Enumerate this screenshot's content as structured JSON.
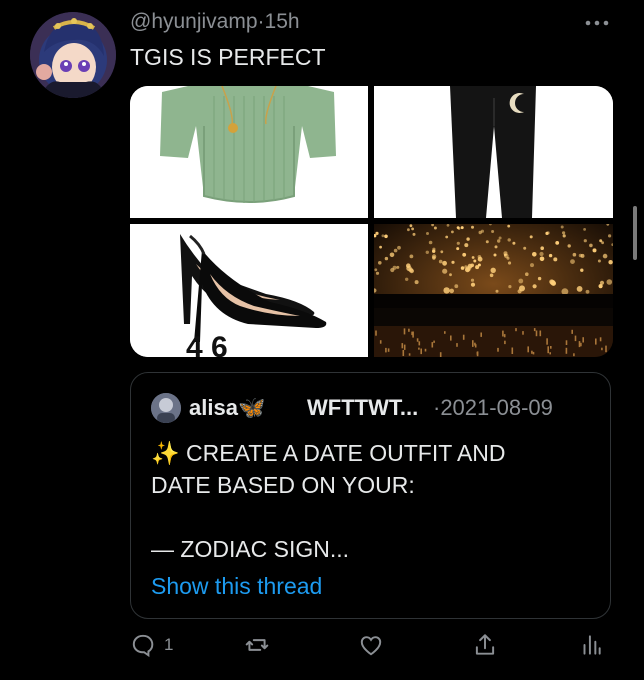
{
  "tweet": {
    "handle": "@hyunjivamp",
    "separator": "·",
    "time": "15h",
    "text": "TGIS IS PERFECT",
    "more_icon": "more-horizontal-icon"
  },
  "media": {
    "images": [
      {
        "name": "green-knit-top-image"
      },
      {
        "name": "black-moon-pants-image"
      },
      {
        "name": "black-slingback-heels-image"
      },
      {
        "name": "sky-lanterns-image"
      }
    ],
    "cutoff_text": "4 6"
  },
  "quote": {
    "name": "alisa",
    "name_emoji": "🦋",
    "handle": "WFTTWT...",
    "date": "·2021-08-09",
    "body_line1": "✨ CREATE A DATE OUTFIT AND",
    "body_line2": "DATE BASED ON YOUR:",
    "body_line3": "— ZODIAC SIGN...",
    "show_thread": "Show this thread"
  },
  "actions": {
    "reply_count": "1",
    "icons": [
      "reply-icon",
      "retweet-icon",
      "like-icon",
      "share-icon",
      "analytics-icon"
    ]
  },
  "colors": {
    "background": "#000000",
    "text": "#e7e9ea",
    "muted": "#8b8f94",
    "link": "#1d9bf0",
    "border": "#2f3336"
  }
}
